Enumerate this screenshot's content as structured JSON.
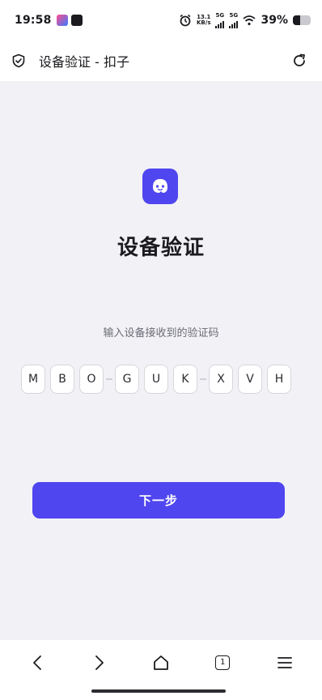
{
  "status": {
    "time": "19:58",
    "net_speed_value": "13.1",
    "net_speed_unit": "KB/s",
    "signal_1": "5G",
    "signal_2": "5G",
    "battery": "39%",
    "battery_level": 0.39
  },
  "browser": {
    "title": "设备验证 - 扣子"
  },
  "page": {
    "heading": "设备验证",
    "subtitle": "输入设备接收到的验证码",
    "code_groups": [
      [
        "M",
        "B",
        "O"
      ],
      [
        "G",
        "U",
        "K"
      ],
      [
        "X",
        "V",
        "H"
      ]
    ],
    "next_label": "下一步"
  },
  "nav": {
    "tab_count": "1",
    "icons": [
      "back-icon",
      "forward-icon",
      "home-icon",
      "tabs-icon",
      "menu-icon"
    ]
  },
  "colors": {
    "accent": "#5046ef",
    "background": "#f2f2f6"
  }
}
